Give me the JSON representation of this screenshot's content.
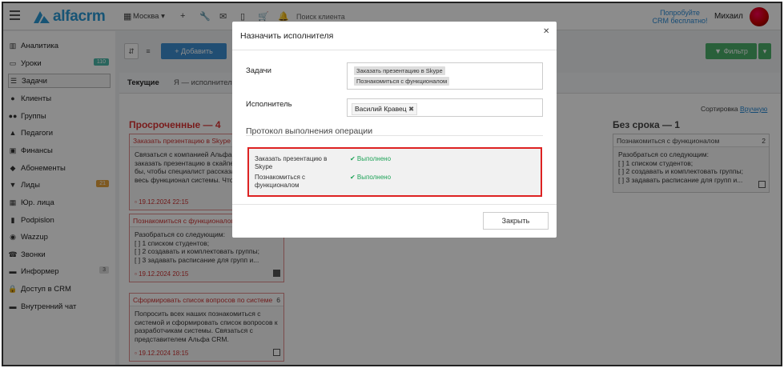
{
  "topbar": {
    "logo_text": "alfacrm",
    "city": "Москва",
    "search_placeholder": "Поиск клиента",
    "promo_line1": "Попробуйте",
    "promo_line2": "CRM бесплатно!",
    "user_name": "Михаил"
  },
  "sidebar": {
    "items": [
      {
        "label": "Аналитика",
        "icon": "chart-icon"
      },
      {
        "label": "Уроки",
        "icon": "calendar-icon",
        "badge": "110"
      },
      {
        "label": "Задачи",
        "icon": "tasks-icon"
      },
      {
        "label": "Клиенты",
        "icon": "user-icon"
      },
      {
        "label": "Группы",
        "icon": "users-icon"
      },
      {
        "label": "Педагоги",
        "icon": "graduation-icon"
      },
      {
        "label": "Финансы",
        "icon": "money-icon"
      },
      {
        "label": "Абонементы",
        "icon": "tag-icon"
      },
      {
        "label": "Лиды",
        "icon": "funnel-icon",
        "badge": "21"
      },
      {
        "label": "Юр. лица",
        "icon": "building-icon"
      },
      {
        "label": "Podpislon",
        "icon": "document-icon"
      },
      {
        "label": "Wazzup",
        "icon": "whatsapp-icon"
      },
      {
        "label": "Звонки",
        "icon": "phone-icon"
      },
      {
        "label": "Информер",
        "icon": "inbox-icon",
        "badge": "3"
      },
      {
        "label": "Доступ в CRM",
        "icon": "lock-icon"
      },
      {
        "label": "Внутренний чат",
        "icon": "chat-icon"
      }
    ]
  },
  "toolbar": {
    "add_label": "+ Добавить",
    "filter_label": "Фильтр"
  },
  "tabs": {
    "current": "Текущие",
    "mine": "Я — исполнитель"
  },
  "board": {
    "sort_label": "Сортировка",
    "sort_value": "Вручную",
    "overdue_title": "Просроченные — 4",
    "nodate_title": "Без срока — 1",
    "cards": [
      {
        "title": "Заказать презентацию в Skype",
        "num": "",
        "body": "Связаться с компанией Альфа CRM и заказать презентацию в скайпе. Хотелось бы, чтобы специалист рассказал и показал весь функционал системы. Чтобы нам",
        "date": "19.12.2024 22:15"
      },
      {
        "title": "Познакомиться с функционалом",
        "num": "",
        "body": "Разобраться со следующим:\n[ ] 1 списком студентов;\n[ ] 2 создавать и комплектовать группы;\n[ ] 3 задавать расписание для групп и...",
        "date": "19.12.2024 20:15"
      },
      {
        "title": "Сформировать список вопросов по системе",
        "num": "6",
        "body": "Попросить всех наших познакомиться с системой и сформировать список вопросов к разработчикам системы. Связаться с представителем Альфа CRM.",
        "date": "19.12.2024 18:15"
      },
      {
        "title": "Познакомиться с функционалом",
        "num": "2",
        "body": "Разобраться со следующим:\n[ ] 1 списком студентов;\n[ ] 2 создавать и комплектовать группы;\n[ ] 3 задавать расписание для групп и..."
      }
    ]
  },
  "modal": {
    "title": "Назначить исполнителя",
    "tasks_label": "Задачи",
    "tasks": [
      "Заказать презентацию в Skype",
      "Познакомиться с функционалом"
    ],
    "executor_label": "Исполнитель",
    "executor": "Василий Кравец",
    "protocol_title": "Протокол выполнения операции",
    "log": [
      {
        "task": "Заказать презентацию в Skype",
        "status": "✔ Выполнено"
      },
      {
        "task": "Познакомиться с функционалом",
        "status": "✔ Выполнено"
      }
    ],
    "close_label": "Закрыть"
  }
}
